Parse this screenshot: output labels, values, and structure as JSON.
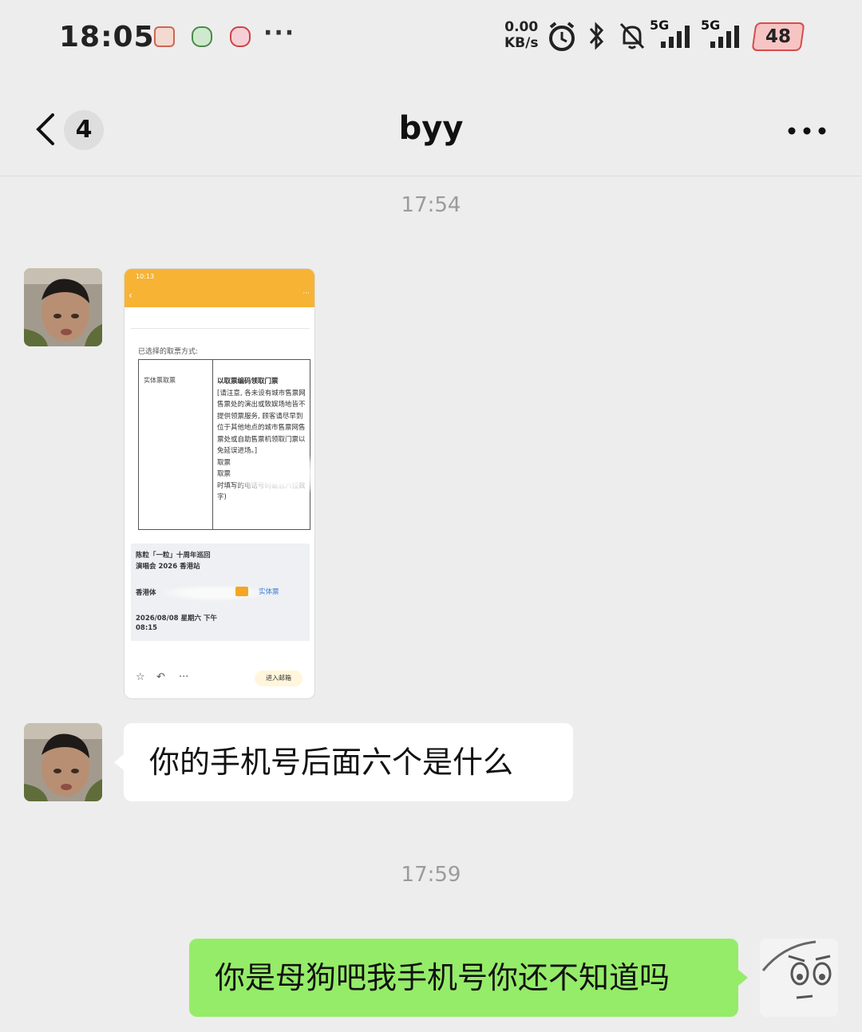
{
  "status_bar": {
    "time": "18:05",
    "more": "···",
    "net_speed_value": "0.00",
    "net_speed_unit": "KB/s",
    "sim1": "5G",
    "sim2": "5G",
    "battery": "48",
    "icons": [
      "app-notification-icon",
      "app-notification-icon",
      "app-notification-icon",
      "alarm-icon",
      "bluetooth-icon",
      "silent-bell-icon",
      "signal-icon",
      "signal-icon"
    ]
  },
  "header": {
    "unread_count": "4",
    "title": "byy"
  },
  "messages": [
    {
      "type": "timestamp",
      "text": "17:54"
    },
    {
      "type": "image",
      "from": "contact",
      "screenshot": {
        "status_time": "10:13",
        "choose_label": "已选择的取票方式:",
        "method_left": "实体票取票",
        "method_title": "以取票编码领取门票",
        "method_body": "[请注意, 各未设有城市售票网售票处的演出或致娱场地皆不提供领票服务, 顾客请尽早到位于其他地点的城市售票网售票处或自助售票机领取门票以免延误进场。]",
        "code_label": "取票",
        "pw_label": "取票",
        "pw_hint": "时填写的电话号码最后六位数字)",
        "event_title_1": "陈粒「一粒」十周年巡回",
        "event_title_2": "演唱会 2026 香港站",
        "venue": "香港体",
        "ticket_type": "实体票",
        "date_1": "2026/08/08 星期六 下午",
        "date_2": "08:15",
        "mailbox_button": "进入邮箱"
      }
    },
    {
      "type": "text",
      "from": "contact",
      "text": "你的手机号后面六个是什么"
    },
    {
      "type": "timestamp",
      "text": "17:59"
    },
    {
      "type": "text",
      "from": "me",
      "text": "你是母狗吧我手机号你还不知道吗"
    }
  ],
  "colors": {
    "background": "#ededed",
    "outgoing_bubble": "#95ec69",
    "incoming_bubble": "#ffffff",
    "timestamp_text": "#9b9b9b"
  }
}
